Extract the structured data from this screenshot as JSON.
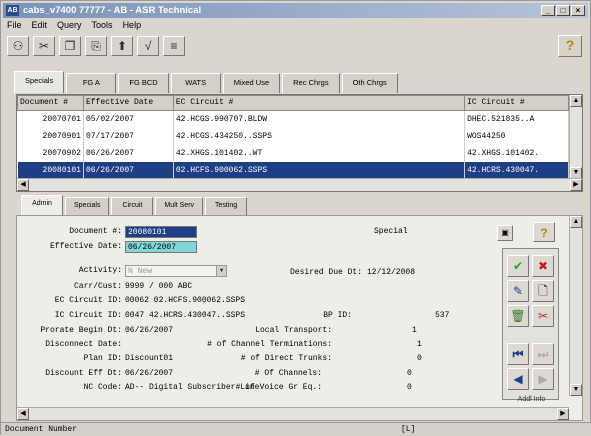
{
  "window": {
    "app_icon": "AB",
    "title": "cabs_v7400 77777 - AB - ASR Technical",
    "min": "_",
    "max": "□",
    "close": "×"
  },
  "menu": [
    "File",
    "Edit",
    "Query",
    "Tools",
    "Help"
  ],
  "toolbar": {
    "icons": [
      "key-icon",
      "scissors-icon",
      "copy-icon",
      "paste-icon",
      "upload-icon",
      "formula-icon",
      "chart-icon"
    ],
    "glyphs": [
      "⚇",
      "✂",
      "❐",
      "⎘",
      "⬆",
      "√",
      "≡"
    ],
    "help": "?"
  },
  "tabs": [
    "Specials",
    "FG A",
    "FG BCD",
    "WATS",
    "Mixed Use",
    "Rec Chrgs",
    "Oth Chrgs"
  ],
  "grid": {
    "headers": [
      "Document #",
      "Effective Date",
      "EC Circuit #",
      "IC Circuit #"
    ],
    "rows": [
      [
        "20070701",
        "05/02/2007",
        "42.HCGS.990707.BLDW",
        "DHEC.521835..A"
      ],
      [
        "20070901",
        "07/17/2007",
        "42.HCGS.434250..SSPS",
        "WOS44250"
      ],
      [
        "20070902",
        "06/26/2007",
        "42.XHGS.101402..WT",
        "42.XHGS.101402."
      ],
      [
        "20080101",
        "06/26/2007",
        "02.HCFS.900062.SSPS",
        "42.HCRS.430047."
      ]
    ],
    "selected_row": 3
  },
  "subtabs": [
    "Admin",
    "Specials",
    "Circuit",
    "Mult Serv",
    "Testing"
  ],
  "form": {
    "document_label": "Document #:",
    "document_value": "20080101",
    "type_value": "Special",
    "eff_date_label": "Effective Date:",
    "eff_date_value": "06/26/2007",
    "activity_label": "Activity:",
    "activity_value": "N New",
    "desired_label": "Desired Due Dt:",
    "desired_value": "12/12/2008",
    "carr_label": "Carr/Cust:",
    "carr_value": "9999 / 000  ABC",
    "ec_label": "EC Circuit ID:",
    "ec_value": "00062  02.HCFS.900062.SSPS",
    "ic_label": "IC Circuit ID:",
    "ic_value": "0047  42.HCRS.430047..SSPS",
    "bp_label": "BP ID:",
    "bp_value": "537",
    "prorate_label": "Prorate Begin Dt:",
    "prorate_value": "06/26/2007",
    "local_label": "Local Transport:",
    "local_value": "1",
    "disconnect_label": "Disconnect Date:",
    "chan_term_label": "# of Channel Terminations:",
    "chan_term_value": "1",
    "plan_label": "Plan ID:",
    "plan_value": "Discount01",
    "direct_label": "# of Direct Trunks:",
    "direct_value": "0",
    "disc_eff_label": "Discount Eff Dt:",
    "disc_eff_value": "06/26/2007",
    "channels_label": "# Of Channels:",
    "channels_value": "0",
    "nc_label": "NC Code:",
    "nc_value": "AD-- Digital Subscriber Line",
    "voice_label": "# of Voice Gr Eq.:",
    "voice_value": "0"
  },
  "actions": {
    "help": "?",
    "partial": "Addl Info"
  },
  "status": {
    "text": "Document Number",
    "code": "[L]"
  }
}
